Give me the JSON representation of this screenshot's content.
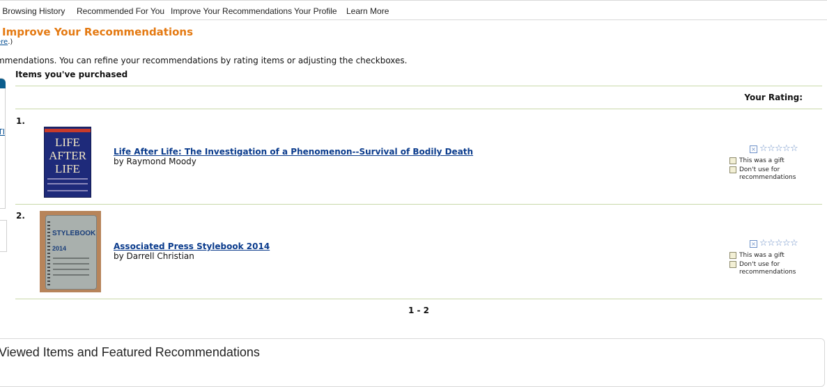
{
  "nav": {
    "items": [
      "r Browsing History",
      "Recommended For You",
      "Improve Your Recommendations",
      "Your Profile",
      "Learn More"
    ]
  },
  "page": {
    "title": "Improve Your Recommendations",
    "here_prefix": "(",
    "here_link": "ere",
    "here_suffix": ".)",
    "intro": "mmendations. You can refine your recommendations by rating items or adjusting the checkboxes.",
    "accent_color": "#e47911"
  },
  "left_panel": {
    "link1": "l",
    "link2": "TI"
  },
  "section": {
    "heading": "Items you've purchased",
    "rating_heading": "Your Rating:"
  },
  "items": [
    {
      "number": "1.",
      "title": "Life After Life: The Investigation of a Phenomenon--Survival of Bodily Death",
      "author": "by Raymond Moody",
      "cover_text": "LIFE AFTER LIFE",
      "stars_rated": 0,
      "gift_label": "This was a gift",
      "dont_use_label_1": "Don't use for",
      "dont_use_label_2": "recommendations"
    },
    {
      "number": "2.",
      "title": "Associated Press Stylebook 2014",
      "author": "by Darrell Christian",
      "cover_text_1": "STYLEBOOK",
      "cover_text_2": "2014",
      "stars_rated": 0,
      "gift_label": "This was a gift",
      "dont_use_label_1": "Don't use for",
      "dont_use_label_2": "recommendations"
    }
  ],
  "pager": "1 - 2",
  "bottom": {
    "title": "Viewed Items and Featured Recommendations"
  }
}
